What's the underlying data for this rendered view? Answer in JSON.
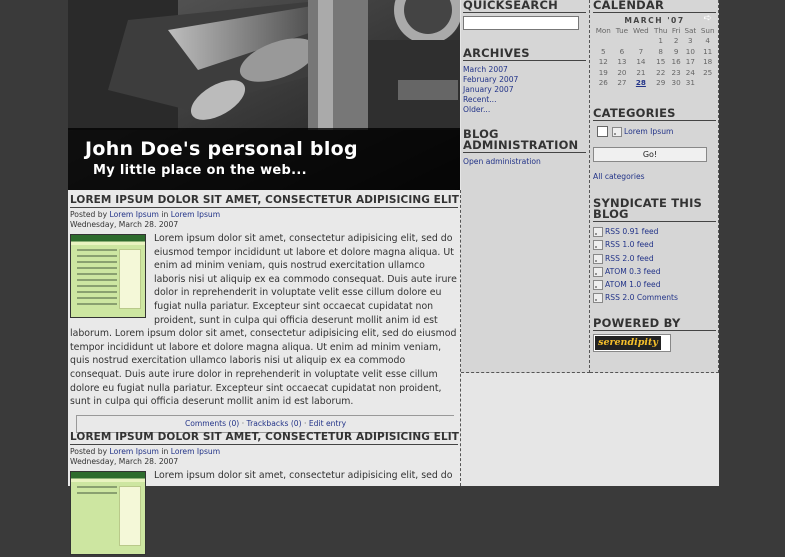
{
  "header": {
    "title": "John Doe's personal blog",
    "subtitle": "My little place on the web..."
  },
  "entries": [
    {
      "title": "LOREM IPSUM DOLOR SIT AMET, CONSECTETUR ADIPISICING ELIT",
      "posted_prefix": "Posted by",
      "author": "Lorem Ipsum",
      "in_word": "in",
      "category": "Lorem Ipsum",
      "date": "Wednesday, March 28. 2007",
      "body": "Lorem ipsum dolor sit amet, consectetur adipisicing elit, sed do eiusmod tempor incididunt ut labore et dolore magna aliqua. Ut enim ad minim veniam, quis nostrud exercitation ullamco laboris nisi ut aliquip ex ea commodo consequat. Duis aute irure dolor in reprehenderit in voluptate velit esse cillum dolore eu fugiat nulla pariatur. Excepteur sint occaecat cupidatat non proident, sunt in culpa qui officia deserunt mollit anim id est laborum. Lorem ipsum dolor sit amet, consectetur adipisicing elit, sed do eiusmod tempor incididunt ut labore et dolore magna aliqua. Ut enim ad minim veniam, quis nostrud exercitation ullamco laboris nisi ut aliquip ex ea commodo consequat. Duis aute irure dolor in reprehenderit in voluptate velit esse cillum dolore eu fugiat nulla pariatur. Excepteur sint occaecat cupidatat non proident, sunt in culpa qui officia deserunt mollit anim id est laborum.",
      "comments": "Comments (0)",
      "trackbacks": "Trackbacks (0)",
      "edit": "Edit entry",
      "sep": "·"
    },
    {
      "title": "LOREM IPSUM DOLOR SIT AMET, CONSECTETUR ADIPISICING ELIT",
      "posted_prefix": "Posted by",
      "author": "Lorem Ipsum",
      "in_word": "in",
      "category": "Lorem Ipsum",
      "date": "Wednesday, March 28. 2007",
      "body": "Lorem ipsum dolor sit amet, consectetur adipisicing elit, sed do"
    }
  ],
  "quicksearch": {
    "heading": "QUICKSEARCH",
    "value": ""
  },
  "archives": {
    "heading": "ARCHIVES",
    "items": [
      "March 2007",
      "February 2007",
      "January 2007",
      "Recent...",
      "Older..."
    ]
  },
  "blog_admin": {
    "heading": "BLOG ADMINISTRATION",
    "link": "Open administration"
  },
  "calendar": {
    "heading": "CALENDAR",
    "month": "MARCH '07",
    "next": "➪",
    "weekdays": [
      "Mon",
      "Tue",
      "Wed",
      "Thu",
      "Fri",
      "Sat",
      "Sun"
    ],
    "weeks": [
      [
        "",
        "",
        "",
        "1",
        "2",
        "3",
        "4"
      ],
      [
        "5",
        "6",
        "7",
        "8",
        "9",
        "10",
        "11"
      ],
      [
        "12",
        "13",
        "14",
        "15",
        "16",
        "17",
        "18"
      ],
      [
        "19",
        "20",
        "21",
        "22",
        "23",
        "24",
        "25"
      ],
      [
        "26",
        "27",
        "28",
        "29",
        "30",
        "31",
        ""
      ]
    ],
    "highlighted_day": "28"
  },
  "categories": {
    "heading": "CATEGORIES",
    "items": [
      "Lorem Ipsum"
    ],
    "go_label": "Go!",
    "all_label": "All categories"
  },
  "syndicate": {
    "heading": "SYNDICATE THIS BLOG",
    "feeds": [
      "RSS 0.91 feed",
      "RSS 1.0 feed",
      "RSS 2.0 feed",
      "ATOM 0.3 feed",
      "ATOM 1.0 feed",
      "RSS 2.0 Comments"
    ]
  },
  "powered": {
    "heading": "POWERED BY",
    "badge": "serendipity"
  }
}
